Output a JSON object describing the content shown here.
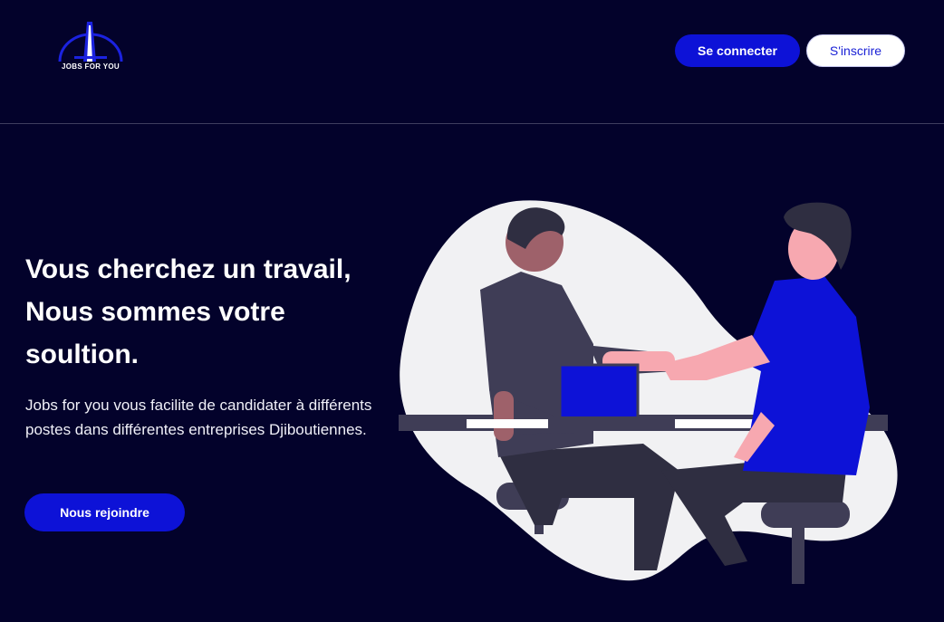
{
  "header": {
    "logo_text": "JOBS FOR YOU",
    "login_label": "Se connecter",
    "signup_label": "S'inscrire"
  },
  "hero": {
    "title": "Vous cherchez un travail, Nous sommes votre soultion.",
    "description": "Jobs for you vous facilite de candidater à différents postes dans différentes entreprises Djiboutiennes.",
    "cta_label": "Nous rejoindre"
  },
  "colors": {
    "background": "#03022b",
    "accent": "#0d12d7",
    "blob": "#f1f1f3"
  },
  "icons": {
    "logo": "tower-logo-icon",
    "illustration": "handshake-illustration"
  }
}
